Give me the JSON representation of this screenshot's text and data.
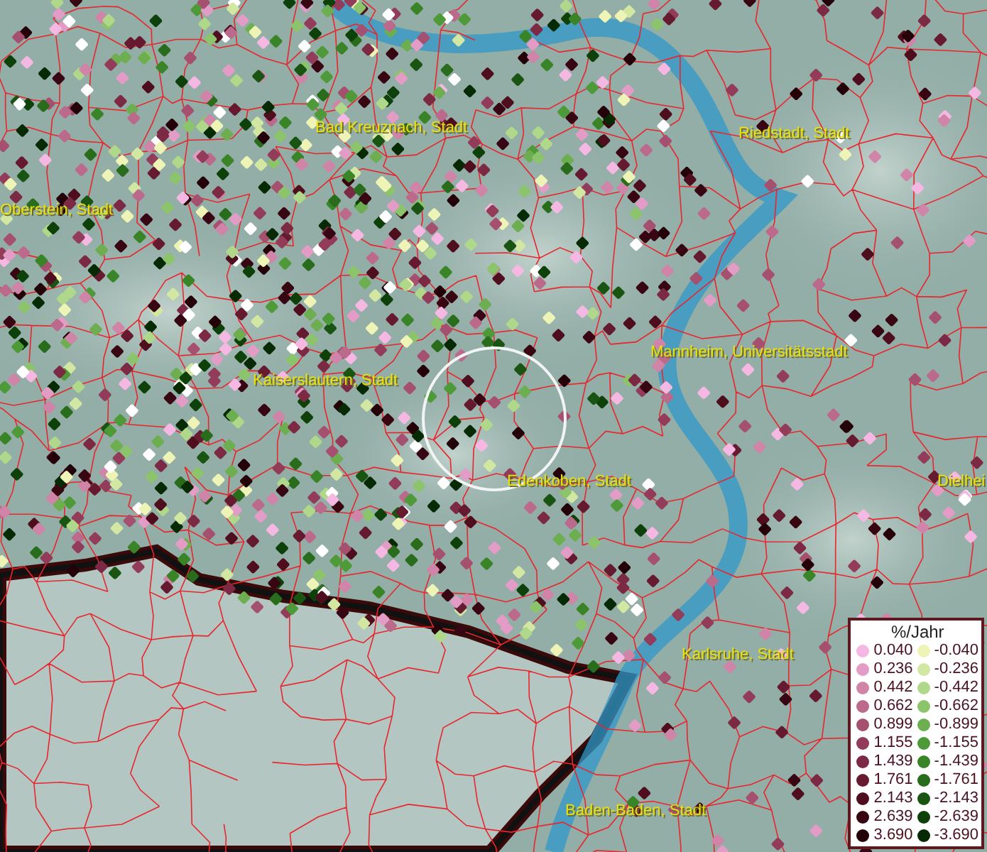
{
  "map": {
    "places": [
      {
        "name": "Bad Kreuznach, Stadt"
      },
      {
        "name": "Riedstadt, Stadt"
      },
      {
        "name": "Oberstein, Stadt"
      },
      {
        "name": "Mannheim, Universitätsstadt"
      },
      {
        "name": "Kaiserslautern, Stadt"
      },
      {
        "name": "Edenkoben, Stadt"
      },
      {
        "name": "Dielhei"
      },
      {
        "name": "Karlsruhe, Stadt"
      },
      {
        "name": "Baden-Baden, Stadt"
      }
    ]
  },
  "legend": {
    "title": "%/Jahr",
    "rows": [
      {
        "left": {
          "value": "0.040",
          "color": "#f4b8e2"
        },
        "right": {
          "value": "-0.040",
          "color": "#eef4b6"
        }
      },
      {
        "left": {
          "value": "0.236",
          "color": "#e29cc6"
        },
        "right": {
          "value": "-0.236",
          "color": "#d2e8a2"
        }
      },
      {
        "left": {
          "value": "0.442",
          "color": "#d084a8"
        },
        "right": {
          "value": "-0.442",
          "color": "#b0d88a"
        }
      },
      {
        "left": {
          "value": "0.662",
          "color": "#bc6a8c"
        },
        "right": {
          "value": "-0.662",
          "color": "#8cc46c"
        }
      },
      {
        "left": {
          "value": "0.899",
          "color": "#a65070"
        },
        "right": {
          "value": "-0.899",
          "color": "#6cae50"
        }
      },
      {
        "left": {
          "value": "1.155",
          "color": "#923c5a"
        },
        "right": {
          "value": "-1.155",
          "color": "#4e9a38"
        }
      },
      {
        "left": {
          "value": "1.439",
          "color": "#7c2a44"
        },
        "right": {
          "value": "-1.439",
          "color": "#3a8428"
        }
      },
      {
        "left": {
          "value": "1.761",
          "color": "#661a30"
        },
        "right": {
          "value": "-1.761",
          "color": "#286c1c"
        }
      },
      {
        "left": {
          "value": "2.143",
          "color": "#4e0e1e"
        },
        "right": {
          "value": "-2.143",
          "color": "#1a5412"
        }
      },
      {
        "left": {
          "value": "2.639",
          "color": "#380612"
        },
        "right": {
          "value": "-2.639",
          "color": "#0e400a"
        }
      },
      {
        "left": {
          "value": "3.690",
          "color": "#240008"
        },
        "right": {
          "value": "-3.690",
          "color": "#062a04"
        }
      }
    ]
  }
}
